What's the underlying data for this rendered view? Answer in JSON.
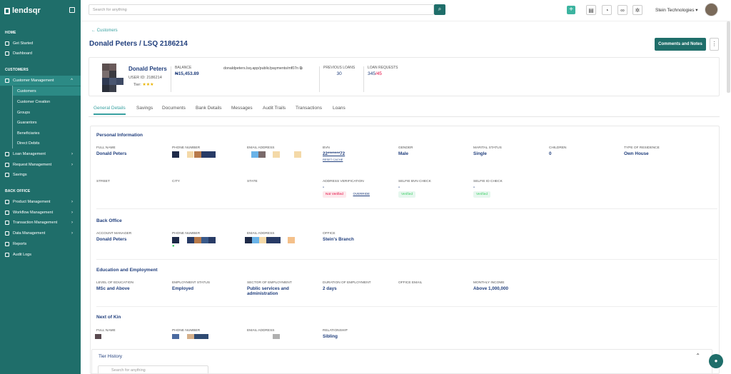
{
  "sidebar": {
    "brand": "lendsqr",
    "home_label": "HOME",
    "items_home": [
      "Get Started",
      "Dashboard"
    ],
    "customers_label": "CUSTOMERS",
    "customer_management": "Customer Management",
    "cm_sub": [
      "Customers",
      "Customer Creation",
      "Groups",
      "Guarantors",
      "Beneficiaries",
      "Direct Debits"
    ],
    "items_customers": [
      "Loan Management",
      "Request Management",
      "Savings"
    ],
    "backoffice_label": "BACK OFFICE",
    "items_backoffice": [
      "Product Management",
      "Workflow Management",
      "Transaction Management",
      "Data Management",
      "Reports",
      "Audit Logs"
    ]
  },
  "topbar": {
    "search_placeholder": "Search for anything",
    "org": "Stein Technologies"
  },
  "page": {
    "back": "Customers",
    "title": "Donald Peters / LSQ 2186214",
    "comments_btn": "Comments and Notes"
  },
  "profile": {
    "name": "Donald Peters",
    "user_id": "USER ID: 2186214",
    "tier_label": "Tier:",
    "stars": "★★★",
    "balance_label": "BALANCE",
    "balance": "₦15,453.89",
    "payment_link": "donaldpeters.lsq.app/public/payments/mf07n",
    "prev_loans_label": "PREVIOUS LOANS",
    "prev_loans": "30",
    "loan_req_label": "LOAN REQUESTS",
    "loan_req_a": "345",
    "loan_req_b": "/45"
  },
  "tabs": [
    "General Details",
    "Savings",
    "Documents",
    "Bank Details",
    "Messages",
    "Audit Trails",
    "Transactions",
    "Loans"
  ],
  "personal": {
    "title": "Personal Information",
    "full_name_l": "FULL NAME",
    "full_name": "Donald Peters",
    "phone_l": "PHONE NUMBER",
    "email_l": "EMAIL ADDRESS",
    "bvn_l": "BVN",
    "bvn": "22*******72",
    "reset": "RESET CACHE",
    "gender_l": "GENDER",
    "gender": "Male",
    "marital_l": "MARITAL STATUS",
    "marital": "Single",
    "children_l": "CHILDREN",
    "children": "0",
    "residence_l": "TYPE OF RESIDENCE",
    "residence": "Own House",
    "street_l": "STREET",
    "city_l": "CITY",
    "state_l": "STATE",
    "addr_l": "ADDRESS VERIFICATION",
    "addr_v": "-",
    "not_verified": "Not Verified",
    "override": "OVERRIDE",
    "sbvn_l": "SELFIE BVN CHECK",
    "sbvn_v": "-",
    "verified1": "Verified",
    "sid_l": "SELFIE ID CHECK",
    "sid_v": "-",
    "verified2": "Verified"
  },
  "backoffice": {
    "title": "Back Office",
    "mgr_l": "ACCOUNT MANAGER",
    "mgr": "Donald Peters",
    "phone_l": "PHONE NUMBER",
    "email_l": "EMAIL ADDRESS",
    "office_l": "OFFICE",
    "office": "Stein's Branch"
  },
  "education": {
    "title": "Education and Employment",
    "level_l": "LEVEL OF EDUCATION",
    "level": "MSc and Above",
    "emp_l": "EMPLOYMENT STATUS",
    "emp": "Employed",
    "sector_l": "SECTOR OF EMPLOYMENT",
    "sector": "Public services and administration",
    "dur_l": "DURATION OF EMPLOYMENT",
    "dur": "2 days",
    "oemail_l": "OFFICE EMAIL",
    "income_l": "MONTHLY INCOME",
    "income": "Above 1,000,000"
  },
  "kin": {
    "title": "Next of Kin",
    "name_l": "FULL NAME",
    "phone_l": "PHONE NUMBER",
    "email_l": "EMAIL ADDRESS",
    "rel_l": "RELATIONSHIP",
    "rel": "Sibling"
  },
  "tier_history": {
    "title": "Tier History",
    "search_placeholder": "Search for anything"
  }
}
